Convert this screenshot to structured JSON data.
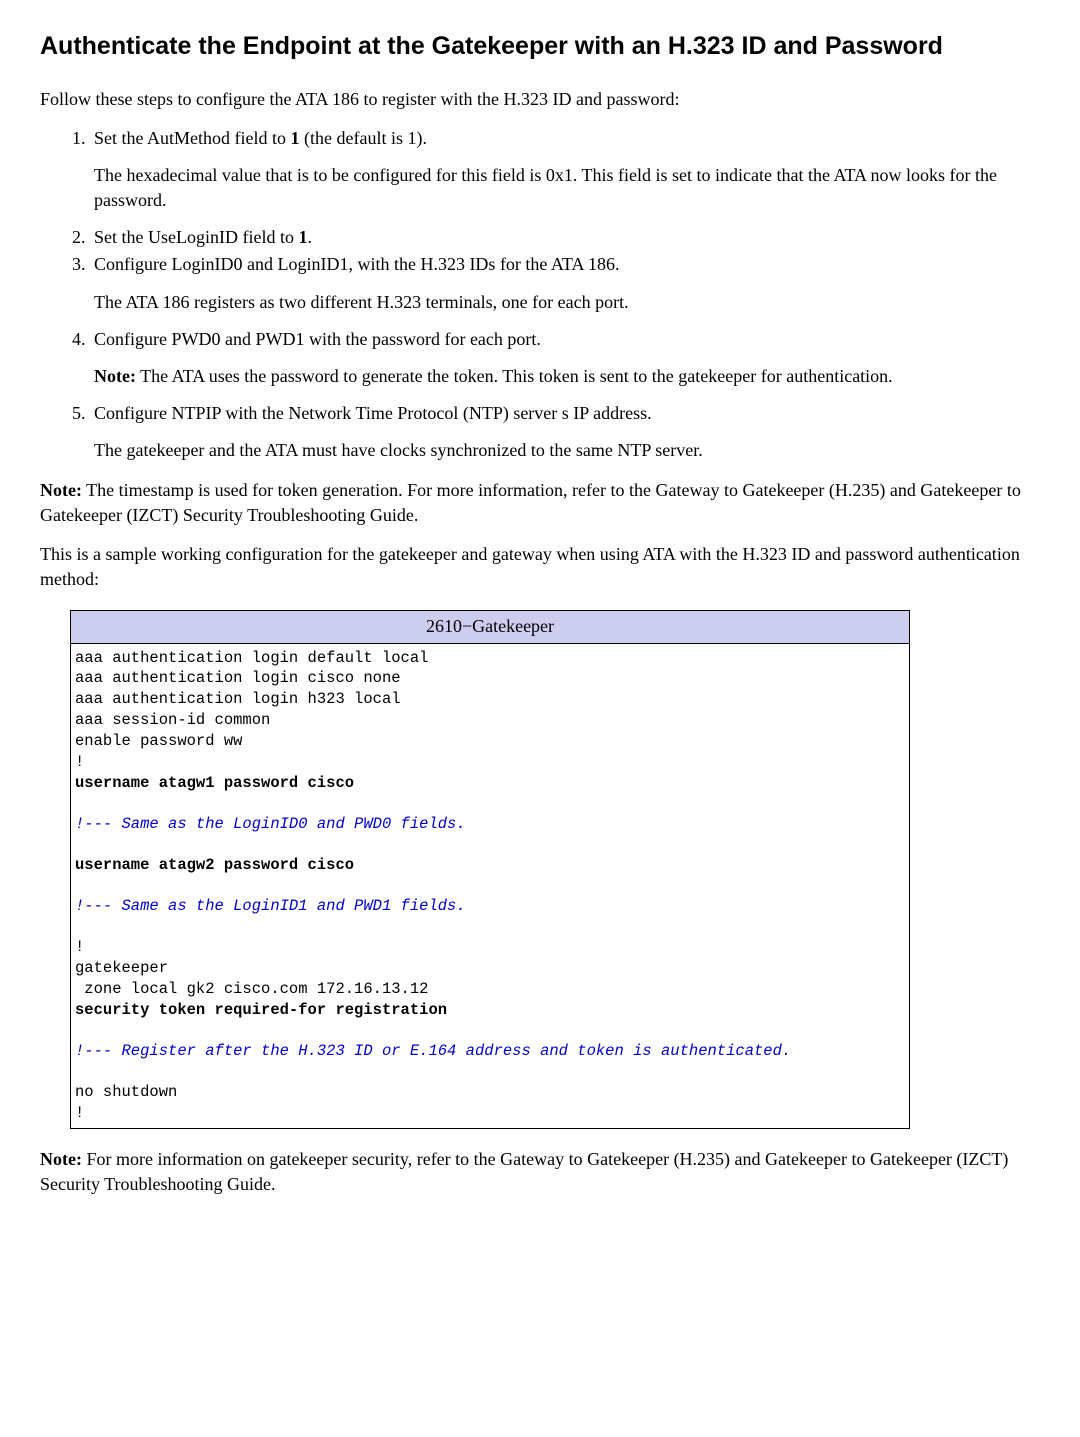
{
  "heading": "Authenticate the Endpoint at the Gatekeeper with an H.323 ID and Password",
  "intro": "Follow these steps to configure the ATA 186 to register with the H.323 ID and password:",
  "steps": {
    "s1a": "Set the AutMethod field to ",
    "s1b": "1",
    "s1c": " (the default is 1).",
    "s1detail": "The hexadecimal value that is to be configured for this field is 0x1. This field is set to indicate that the ATA now looks for the password.",
    "s2a": "Set the UseLoginID field to ",
    "s2b": "1",
    "s2c": ".",
    "s3a": "Configure LoginID0 and LoginID1, with the H.323 IDs for the ATA 186.",
    "s3detail": "The ATA 186 registers as two different H.323 terminals, one for each port.",
    "s4a": "Configure PWD0 and PWD1 with the password for each port.",
    "s4note_label": "Note:",
    "s4note_body": " The ATA uses the password to generate the token. This token is sent to the gatekeeper for authentication.",
    "s5a": "Configure NTPIP with the Network Time Protocol (NTP) server s IP address.",
    "s5detail": "The gatekeeper and the ATA must have clocks synchronized to the same NTP server."
  },
  "note1_label": "Note:",
  "note1_body": " The timestamp is used for token generation. For more information, refer to the Gateway to Gatekeeper (H.235) and Gatekeeper to Gatekeeper (IZCT) Security Troubleshooting Guide.",
  "sample": "This is a sample working configuration for the gatekeeper and gateway when using ATA with the H.323 ID and password authentication method:",
  "config_title": "2610−Gatekeeper",
  "config": {
    "l1": "aaa authentication login default local",
    "l2": "aaa authentication login cisco none",
    "l3": "aaa authentication login h323 local",
    "l4": "aaa session-id common",
    "l5": "enable password ww",
    "l6": "!",
    "l7": "username atagw1 password cisco",
    "l8": "!--- Same as the LoginID0 and PWD0 fields.",
    "l9": "username atagw2 password cisco",
    "l10": "!--- Same as the LoginID1 and PWD1 fields.",
    "l11": "!",
    "l12": "gatekeeper",
    "l13": " zone local gk2 cisco.com 172.16.13.12",
    "l14": "security token required-for registration",
    "l15": "!--- Register after the H.323 ID or E.164 address and token is authenticated.",
    "l16": "no shutdown",
    "l17": "!"
  },
  "note2_label": "Note:",
  "note2_body": " For more information on gatekeeper security, refer to the Gateway to Gatekeeper (H.235) and Gatekeeper to Gatekeeper (IZCT) Security Troubleshooting Guide."
}
